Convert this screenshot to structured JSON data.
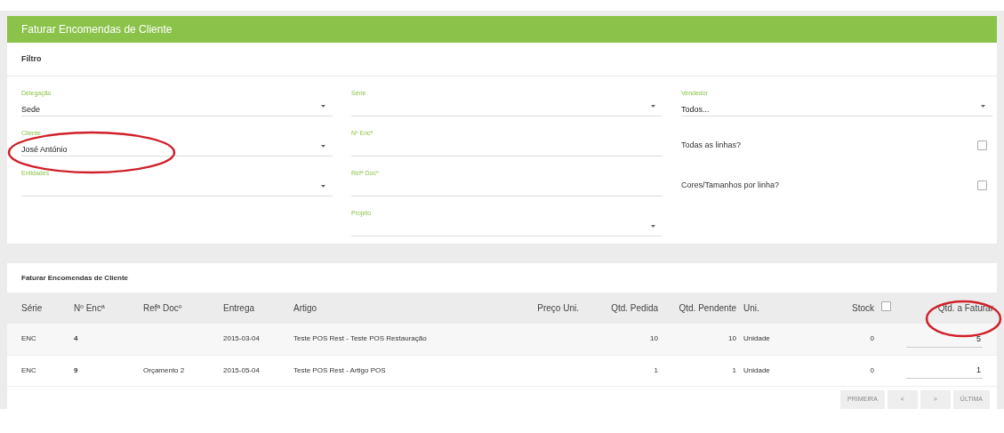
{
  "panel": {
    "title": "Faturar Encomendas de Cliente",
    "filter_title": "Filtro"
  },
  "filter_columns": [
    [
      {
        "kind": "select",
        "label": "Delegação",
        "value": "Sede"
      },
      {
        "kind": "select",
        "label": "Cliente",
        "value": "José António"
      },
      {
        "kind": "select",
        "label": "Entidades"
      }
    ],
    [
      {
        "kind": "select",
        "label": "Série"
      },
      {
        "kind": "input",
        "label": "Nº Encª"
      },
      {
        "kind": "input",
        "label": "Refª Docº"
      },
      {
        "kind": "select",
        "label": "Projeto"
      }
    ],
    [
      {
        "kind": "select",
        "label": "Vendedor",
        "value": "Todos..."
      },
      {
        "kind": "checkbox",
        "label": "Todas as linhas?",
        "checked": false
      },
      {
        "kind": "checkbox",
        "label": "Cores/Tamanhos por linha?",
        "checked": false
      }
    ]
  ],
  "table": {
    "title": "Faturar Encomendas de Cliente",
    "columns": [
      "Série",
      "Nº Encª",
      "Refª Docº",
      "Entrega",
      "Artigo",
      "Preço Uni.",
      "Qtd. Pedida",
      "Qtd. Pendente",
      "Uni.",
      "Stock",
      "Qtd. a Faturar"
    ],
    "select_all_checked": false,
    "rows": [
      {
        "cells": [
          "ENC",
          "4",
          "",
          "2015-03-04",
          "Teste POS Rest - Teste POS Restauração",
          "",
          "10",
          "10",
          "Unidade",
          "0"
        ],
        "qty": "5"
      },
      {
        "cells": [
          "ENC",
          "9",
          "Orçamento 2",
          "2015-05-04",
          "Teste POS Rest - Artigo POS",
          "",
          "1",
          "1",
          "Unidade",
          "0"
        ],
        "qty": "1"
      }
    ]
  },
  "pagination": [
    {
      "label": "PRIMEIRA",
      "disabled": true
    },
    {
      "label": "<",
      "disabled": true
    },
    {
      "label": ">",
      "disabled": true
    },
    {
      "label": "ÚLTIMA",
      "disabled": true
    }
  ],
  "annotations": [
    {
      "kind": "ellipse"
    },
    {
      "kind": "ellipse"
    }
  ]
}
